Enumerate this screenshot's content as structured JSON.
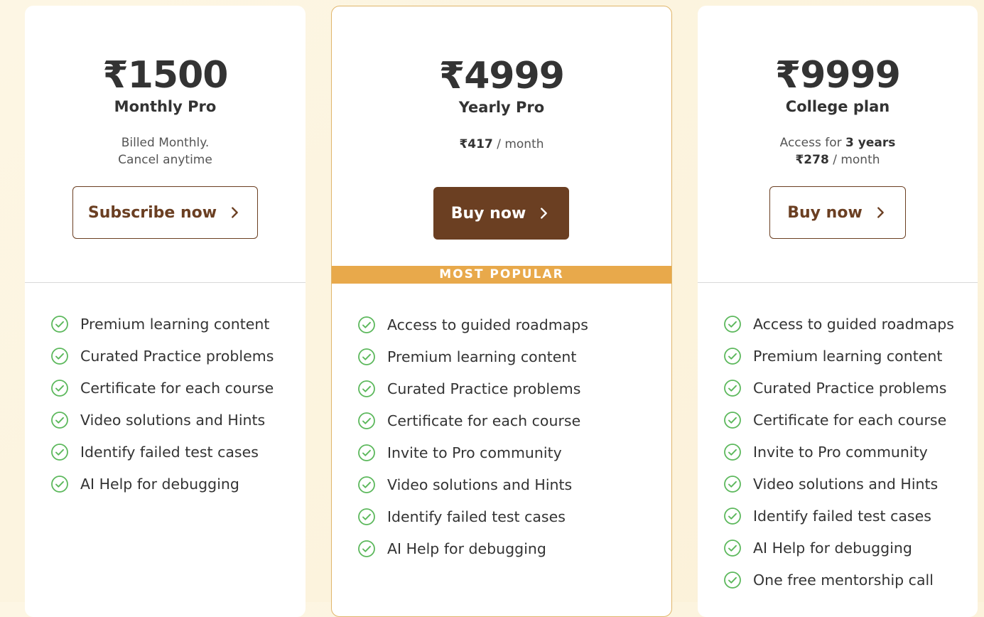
{
  "colors": {
    "brand_brown": "#6b3f22",
    "accent_orange": "#e8a94b",
    "check_green": "#5cb85c"
  },
  "plans": [
    {
      "price": "₹1500",
      "name": "Monthly Pro",
      "sub_line1": "Billed Monthly.",
      "sub_line2": "Cancel anytime",
      "button_label": "Subscribe now",
      "features": [
        "Premium learning content",
        "Curated Practice problems",
        "Certificate for each course",
        "Video solutions and Hints",
        "Identify failed test cases",
        "AI Help for debugging"
      ]
    },
    {
      "price": "₹4999",
      "name": "Yearly Pro",
      "monthly_price": "₹417",
      "monthly_suffix": " / month",
      "button_label": "Buy now",
      "badge": "MOST POPULAR",
      "features": [
        "Access to guided roadmaps",
        "Premium learning content",
        "Curated Practice problems",
        "Certificate for each course",
        "Invite to Pro community",
        "Video solutions and Hints",
        "Identify failed test cases",
        "AI Help for debugging"
      ]
    },
    {
      "price": "₹9999",
      "name": "College plan",
      "access_prefix": "Access for ",
      "access_duration": "3 years",
      "monthly_price": "₹278",
      "monthly_suffix": " / month",
      "button_label": "Buy now",
      "features": [
        "Access to guided roadmaps",
        "Premium learning content",
        "Curated Practice problems",
        "Certificate for each course",
        "Invite to Pro community",
        "Video solutions and Hints",
        "Identify failed test cases",
        "AI Help for debugging",
        "One free mentorship call"
      ]
    }
  ]
}
